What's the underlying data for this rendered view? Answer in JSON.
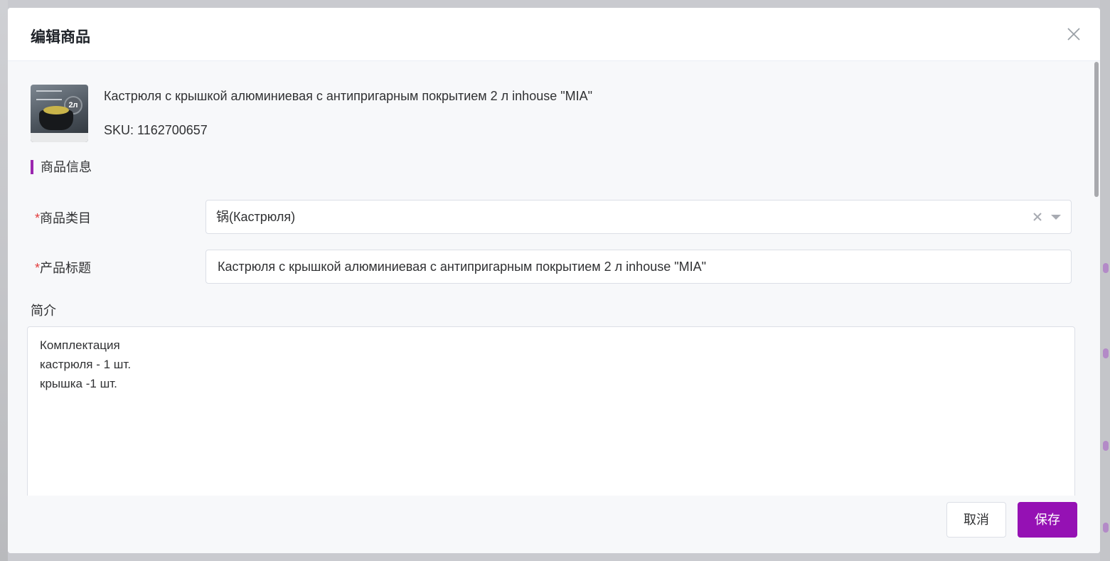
{
  "modal": {
    "title": "编辑商品"
  },
  "product": {
    "name": "Кастрюля с крышкой алюминиевая с антипригарным покрытием 2 л inhouse \"MIA\"",
    "sku": "SKU: 1162700657",
    "thumb_badge": "2л"
  },
  "section": {
    "title": "商品信息"
  },
  "form": {
    "required_mark": "*",
    "category_label": "商品类目",
    "category_value": "锅(Кастрюля)",
    "title_label": "产品标题",
    "title_value": "Кастрюля с крышкой алюминиевая с антипригарным покрытием 2 л inhouse \"MIA\"",
    "desc_label": "简介",
    "desc_value": "Комплектация\nкастрюля - 1 шт.\nкрышка -1 шт."
  },
  "footer": {
    "cancel_label": "取消",
    "save_label": "保存"
  },
  "colors": {
    "accent": "#9511b4",
    "section_bar": "#9b27af",
    "required": "#e23c3c"
  },
  "icons": {
    "close": "close-icon",
    "clear": "clear-icon",
    "dropdown": "caret-down-icon"
  }
}
